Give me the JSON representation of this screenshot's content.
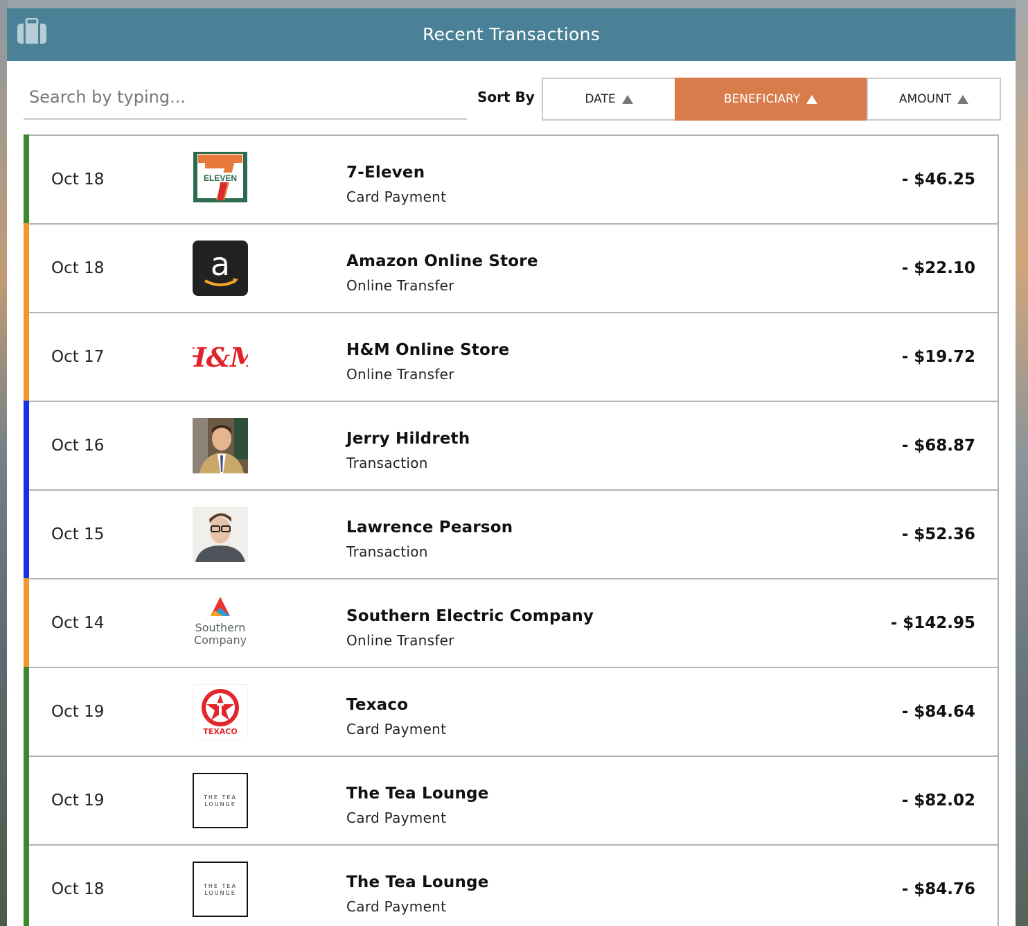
{
  "header": {
    "title": "Recent Transactions",
    "icon": "briefcase-icon"
  },
  "search": {
    "placeholder": "Search by typing..."
  },
  "sort": {
    "label": "Sort By",
    "options": [
      {
        "label": "DATE",
        "active": false
      },
      {
        "label": "BENEFICIARY",
        "active": true
      },
      {
        "label": "AMOUNT",
        "active": false
      }
    ]
  },
  "colors": {
    "header": "#4b8196",
    "active_sort": "#d97c4c",
    "card": "#3a8a2b",
    "online": "#f2962d",
    "transfer": "#1730e8"
  },
  "transactions": [
    {
      "date": "Oct 18",
      "name": "7-Eleven",
      "type": "Card Payment",
      "amount": "- $46.25",
      "logo": "seven-eleven-logo",
      "logo_text": "ELEVEN"
    },
    {
      "date": "Oct 18",
      "name": "Amazon Online Store",
      "type": "Online Transfer",
      "amount": "- $22.10",
      "logo": "amazon-logo",
      "logo_text": "a"
    },
    {
      "date": "Oct 17",
      "name": "H&M Online Store",
      "type": "Online Transfer",
      "amount": "- $19.72",
      "logo": "hm-logo",
      "logo_text": "H&M"
    },
    {
      "date": "Oct 16",
      "name": "Jerry Hildreth",
      "type": "Transaction",
      "amount": "- $68.87",
      "logo": "person-photo"
    },
    {
      "date": "Oct 15",
      "name": "Lawrence Pearson",
      "type": "Transaction",
      "amount": "- $52.36",
      "logo": "person-photo"
    },
    {
      "date": "Oct 14",
      "name": "Southern Electric Company",
      "type": "Online Transfer",
      "amount": "- $142.95",
      "logo": "southern-company-logo",
      "logo_text": "Southern Company"
    },
    {
      "date": "Oct 19",
      "name": "Texaco",
      "type": "Card Payment",
      "amount": "- $84.64",
      "logo": "texaco-logo",
      "logo_text": "TEXACO"
    },
    {
      "date": "Oct 19",
      "name": "The Tea Lounge",
      "type": "Card Payment",
      "amount": "- $82.02",
      "logo": "tea-lounge-logo",
      "logo_text": "THE TEA LOUNGE"
    },
    {
      "date": "Oct 18",
      "name": "The Tea Lounge",
      "type": "Card Payment",
      "amount": "- $84.76",
      "logo": "tea-lounge-logo",
      "logo_text": "THE TEA LOUNGE"
    }
  ]
}
